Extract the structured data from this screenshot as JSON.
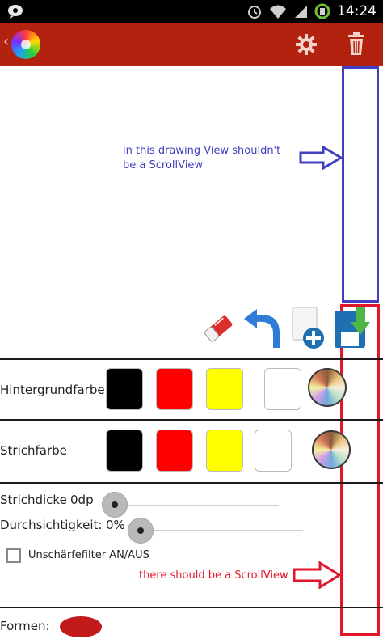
{
  "status_bar": {
    "time": "14:24",
    "icons": [
      "notification-icon",
      "alarm-icon",
      "wifi-icon",
      "signal-icon",
      "battery-icon"
    ]
  },
  "action_bar": {
    "back_glyph": "‹",
    "icons": [
      "app-logo",
      "settings-icon",
      "trash-icon"
    ],
    "color": "#b3220f"
  },
  "annotations": {
    "blue_note": "in this drawing View shouldn't be a ScrollView",
    "red_note": "there should be a ScrollView"
  },
  "toolbar": {
    "icons": [
      "eraser-icon",
      "undo-icon",
      "new-document-icon",
      "save-icon"
    ]
  },
  "background_color": {
    "label": "Hintergrundfarbe",
    "swatches": [
      "#000000",
      "#ff0000",
      "#ffff00",
      "#ffffff"
    ],
    "picker_icon": "color-wheel-icon"
  },
  "stroke_color": {
    "label": "Strichfarbe",
    "swatches": [
      "#000000",
      "#ff0000",
      "#ffff00",
      "#ffffff"
    ],
    "picker_icon": "color-wheel-icon"
  },
  "stroke_width": {
    "label": "Strichdicke",
    "value": "0dp",
    "slider_level": 0
  },
  "transparency": {
    "label": "Durchsichtigkeit:",
    "value": "0%",
    "slider_level": 0
  },
  "blur_filter": {
    "label": "Unschärfefilter AN/AUS",
    "checked": false
  },
  "shapes": {
    "label": "Formen:"
  },
  "colors": {
    "blue_annotation": "#3f3fbf",
    "red_annotation": "#e0162b"
  }
}
